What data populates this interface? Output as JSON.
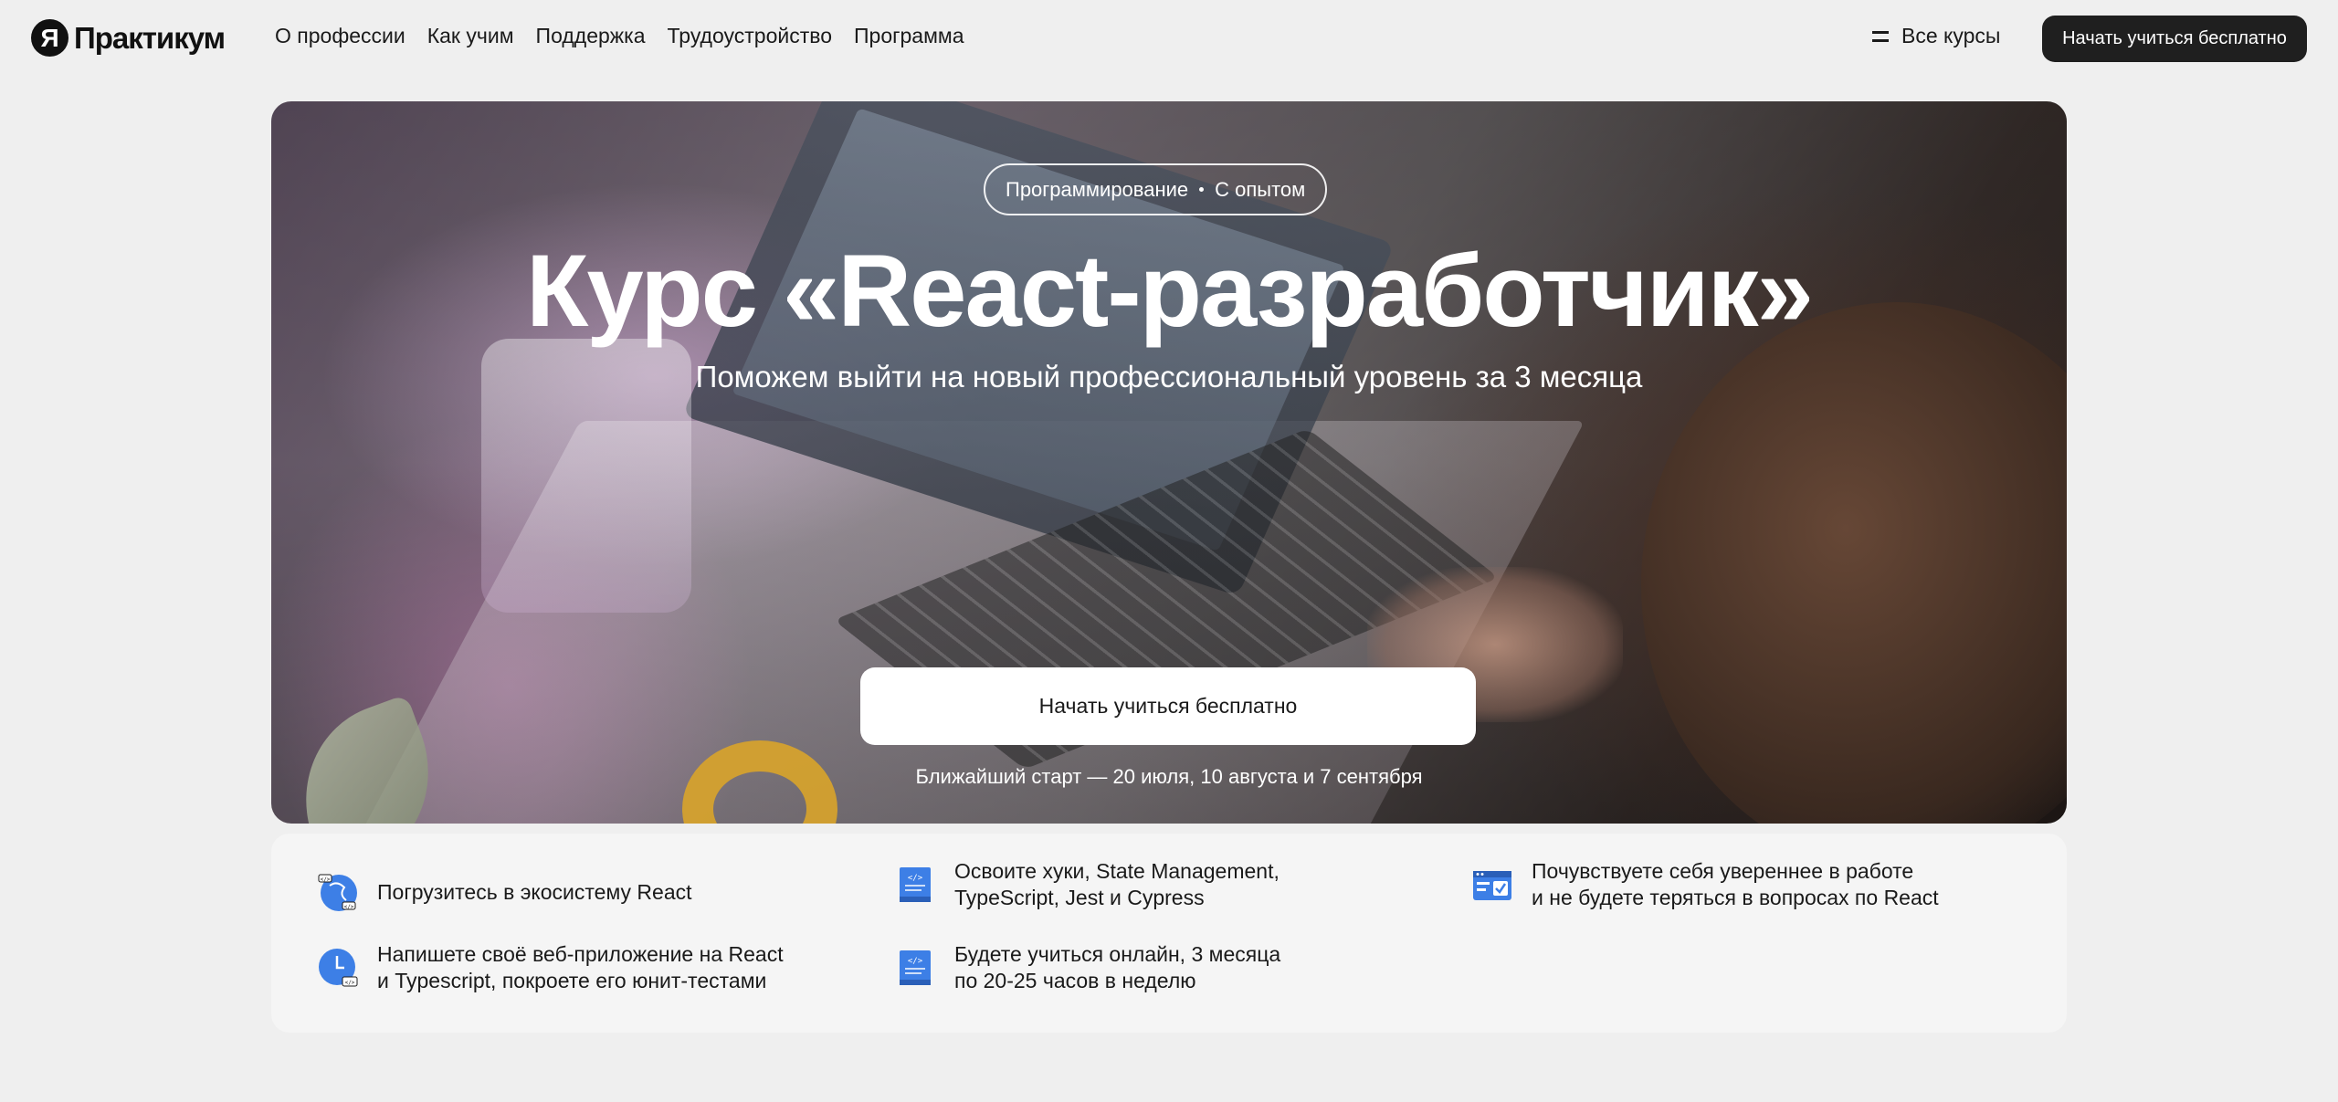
{
  "header": {
    "logo_letter": "Я",
    "logo_text": "Практикум",
    "nav": [
      {
        "label": "О профессии"
      },
      {
        "label": "Как учим"
      },
      {
        "label": "Поддержка"
      },
      {
        "label": "Трудоустройство"
      },
      {
        "label": "Программа"
      }
    ],
    "all_courses_label": "Все курсы",
    "cta_label": "Начать учиться бесплатно"
  },
  "hero": {
    "tag_category": "Программирование",
    "tag_level": "С опытом",
    "title": "Курс «React-разработчик»",
    "subtitle": "Поможем выйти на новый профессиональный уровень за 3 месяца",
    "button_label": "Начать учиться бесплатно",
    "start_dates": "Ближайший старт — 20 июля, 10 августа и 7 сентября"
  },
  "features": [
    {
      "icon": "react-ecosystem-icon",
      "text": "Погрузитесь в экосистему React"
    },
    {
      "icon": "code-book-icon",
      "text": "Освоите хуки, State Management,\nTypeScript, Jest и Cypress"
    },
    {
      "icon": "browser-check-icon",
      "text": "Почувствуете себя увереннее в работе\nи не будете теряться в вопросах по React"
    },
    {
      "icon": "clock-code-icon",
      "text": "Напишете своё веб-приложение на React\nи Typescript, покроете его юнит-тестами"
    },
    {
      "icon": "code-book-icon",
      "text": "Будете учиться онлайн, 3 месяца\nпо 20-25 часов в неделю"
    }
  ],
  "colors": {
    "background": "#efefef",
    "dark_button": "#1f1f1f",
    "accent_blue": "#3d7fe6"
  }
}
